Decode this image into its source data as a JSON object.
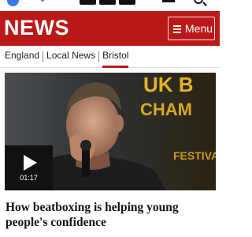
{
  "header": {
    "brand": "NEWS",
    "menu_label": "Menu",
    "background_color": "#bb1919",
    "menu_icon": "hamburger-icon"
  },
  "subnav": {
    "items": [
      {
        "label": "England",
        "active": false
      },
      {
        "label": "Local News",
        "active": false
      },
      {
        "label": "Bristol",
        "active": true
      }
    ],
    "active_color": "#bb1919"
  },
  "hero": {
    "duration": "01:17",
    "play_icon": "play-icon",
    "background_text_lines": [
      "UK B",
      "CHAM",
      "FESTIVAL"
    ]
  },
  "article": {
    "headline": "How beatboxing is helping young people's confidence"
  },
  "status_strip_icons": [
    "app-icon",
    "chevron-icon",
    "search-icon"
  ]
}
